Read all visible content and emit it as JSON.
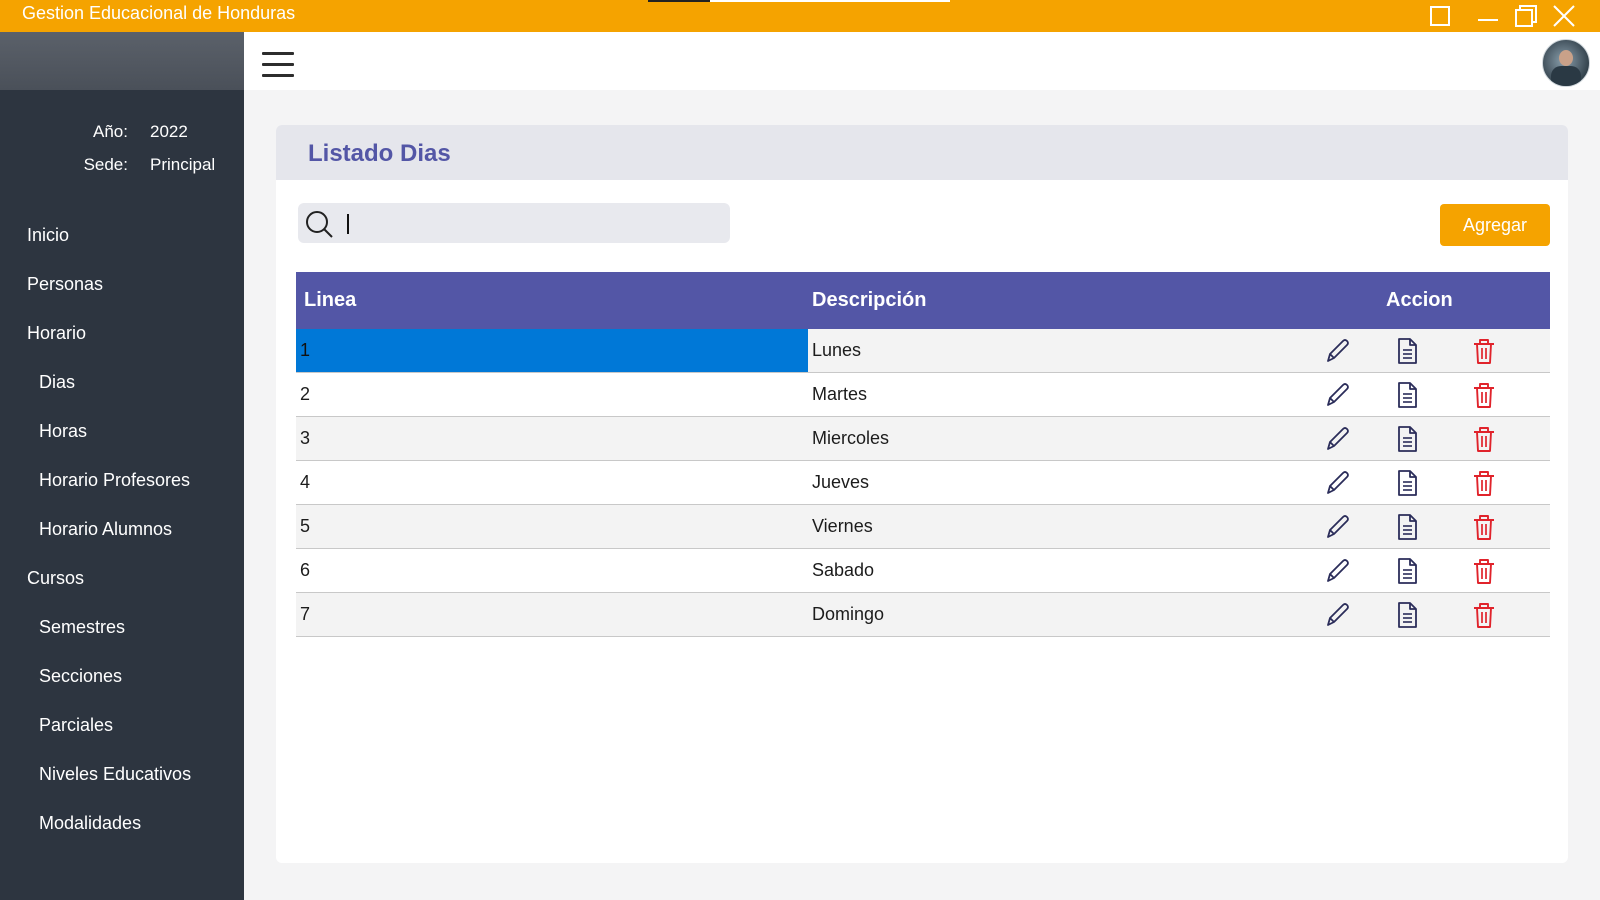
{
  "window": {
    "title": "Gestion Educacional de Honduras",
    "controls": [
      "maximize-square-icon",
      "minimize-icon",
      "restore-icon",
      "close-icon"
    ],
    "accent_color": "#f5a300"
  },
  "sidebar": {
    "year_label": "Año:",
    "year_value": "2022",
    "site_label": "Sede:",
    "site_value": "Principal",
    "items": [
      {
        "label": "Inicio",
        "level": 0
      },
      {
        "label": "Personas",
        "level": 0
      },
      {
        "label": "Horario",
        "level": 0
      },
      {
        "label": "Dias",
        "level": 1
      },
      {
        "label": "Horas",
        "level": 1
      },
      {
        "label": "Horario Profesores",
        "level": 1
      },
      {
        "label": "Horario Alumnos",
        "level": 1
      },
      {
        "label": "Cursos",
        "level": 0
      },
      {
        "label": "Semestres",
        "level": 1
      },
      {
        "label": "Secciones",
        "level": 1
      },
      {
        "label": "Parciales",
        "level": 1
      },
      {
        "label": "Niveles Educativos",
        "level": 1
      },
      {
        "label": "Modalidades",
        "level": 1
      }
    ]
  },
  "header": {
    "menu_icon": "hamburger-menu-icon",
    "avatar": "user-avatar"
  },
  "main": {
    "title": "Listado Dias",
    "search": {
      "value": "",
      "placeholder": ""
    },
    "add_label": "Agregar",
    "table": {
      "columns": [
        "Linea",
        "Descripción",
        "Accion"
      ],
      "header_color": "#5356a6",
      "rows": [
        {
          "linea": "1",
          "descripcion": "Lunes",
          "selected": true
        },
        {
          "linea": "2",
          "descripcion": "Martes"
        },
        {
          "linea": "3",
          "descripcion": "Miercoles"
        },
        {
          "linea": "4",
          "descripcion": "Jueves"
        },
        {
          "linea": "5",
          "descripcion": "Viernes"
        },
        {
          "linea": "6",
          "descripcion": "Sabado"
        },
        {
          "linea": "7",
          "descripcion": "Domingo"
        }
      ],
      "row_actions": [
        "edit-pencil-icon",
        "view-document-icon",
        "delete-trash-icon"
      ]
    }
  }
}
